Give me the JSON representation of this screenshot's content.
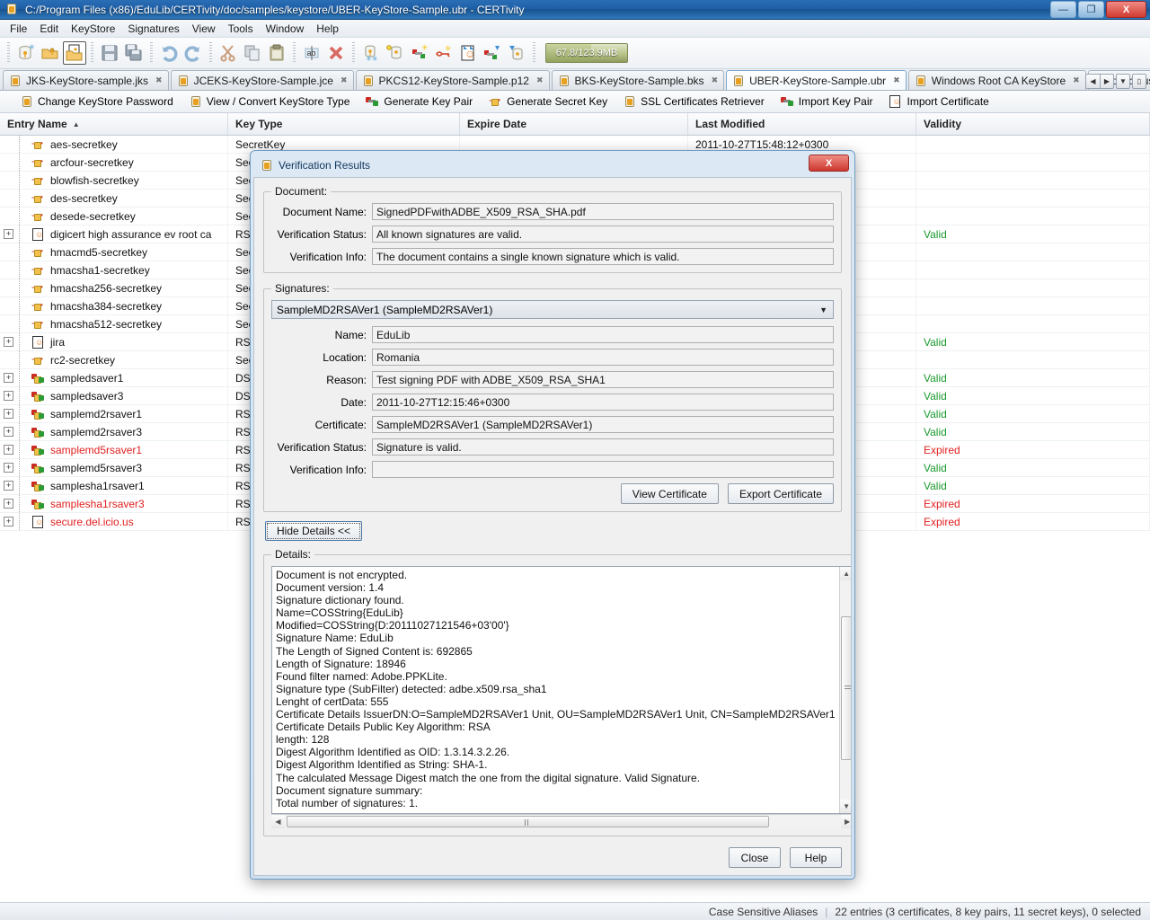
{
  "window": {
    "title": "C:/Program Files (x86)/EduLib/CERTivity/doc/samples/keystore/UBER-KeyStore-Sample.ubr - CERTivity",
    "minimize": "—",
    "maximize": "❐",
    "close": "X"
  },
  "menubar": {
    "items": [
      "File",
      "Edit",
      "KeyStore",
      "Signatures",
      "View",
      "Tools",
      "Window",
      "Help"
    ]
  },
  "toolbar": {
    "memory_label": "67.8/123.9MB",
    "icons": [
      "new-keystore-icon",
      "open-keystore-icon",
      "open-ca-keystore-icon",
      "save-icon",
      "save-all-icon",
      "undo-icon",
      "redo-icon",
      "cut-icon",
      "copy-icon",
      "paste-icon",
      "rename-icon",
      "delete-icon",
      "change-password-icon",
      "view-convert-keystore-icon",
      "generate-key-pair-icon",
      "generate-secret-key-icon",
      "ssl-certificates-retriever-icon",
      "import-key-pair-icon",
      "import-certificate-icon"
    ]
  },
  "tabs": [
    {
      "label": "JKS-KeyStore-sample.jks",
      "icon": "keystore-icon",
      "active": false
    },
    {
      "label": "JCEKS-KeyStore-Sample.jce",
      "icon": "keystore-icon",
      "active": false
    },
    {
      "label": "PKCS12-KeyStore-Sample.p12",
      "icon": "keystore-icon",
      "active": false
    },
    {
      "label": "BKS-KeyStore-Sample.bks",
      "icon": "keystore-icon",
      "active": false
    },
    {
      "label": "UBER-KeyStore-Sample.ubr",
      "icon": "keystore-icon",
      "active": true
    },
    {
      "label": "Windows Root CA KeyStore",
      "icon": "keystore-icon",
      "active": false
    },
    {
      "label": "delicious.cer",
      "icon": "certificate-icon",
      "active": false
    }
  ],
  "tab_close_glyph": "✖",
  "actionbar": {
    "items": [
      {
        "label": "Change KeyStore Password",
        "icon": "change-password-icon"
      },
      {
        "label": "View / Convert KeyStore Type",
        "icon": "view-convert-keystore-icon"
      },
      {
        "label": "Generate Key Pair",
        "icon": "generate-key-pair-icon"
      },
      {
        "label": "Generate Secret Key",
        "icon": "generate-secret-key-icon"
      },
      {
        "label": "SSL Certificates Retriever",
        "icon": "ssl-certificates-retriever-icon"
      },
      {
        "label": "Import Key Pair",
        "icon": "import-key-pair-icon"
      },
      {
        "label": "Import Certificate",
        "icon": "import-certificate-icon"
      }
    ]
  },
  "table": {
    "columns": [
      "Entry Name",
      "Key Type",
      "Expire Date",
      "Last Modified",
      "Validity"
    ],
    "sort_column": "Entry Name",
    "sort_arrow": "▲",
    "rows": [
      {
        "name": "aes-secretkey",
        "icon": "secret-key-icon",
        "expandable": false,
        "key_type": "SecretKey",
        "expire": "",
        "modified": "2011-10-27T15:48:12+0300",
        "validity": ""
      },
      {
        "name": "arcfour-secretkey",
        "icon": "secret-key-icon",
        "expandable": false,
        "key_type": "SecretKey",
        "expire": "",
        "modified": "",
        "validity": ""
      },
      {
        "name": "blowfish-secretkey",
        "icon": "secret-key-icon",
        "expandable": false,
        "key_type": "SecretKey",
        "expire": "",
        "modified": "",
        "validity": ""
      },
      {
        "name": "des-secretkey",
        "icon": "secret-key-icon",
        "expandable": false,
        "key_type": "SecretKey",
        "expire": "",
        "modified": "",
        "validity": ""
      },
      {
        "name": "desede-secretkey",
        "icon": "secret-key-icon",
        "expandable": false,
        "key_type": "SecretKey",
        "expire": "",
        "modified": "",
        "validity": ""
      },
      {
        "name": "digicert high assurance ev root ca",
        "icon": "certificate-icon",
        "expandable": true,
        "key_type": "RSA",
        "expire": "",
        "modified": "",
        "validity": "Valid"
      },
      {
        "name": "hmacmd5-secretkey",
        "icon": "secret-key-icon",
        "expandable": false,
        "key_type": "SecretKey",
        "expire": "",
        "modified": "",
        "validity": ""
      },
      {
        "name": "hmacsha1-secretkey",
        "icon": "secret-key-icon",
        "expandable": false,
        "key_type": "SecretKey",
        "expire": "",
        "modified": "",
        "validity": ""
      },
      {
        "name": "hmacsha256-secretkey",
        "icon": "secret-key-icon",
        "expandable": false,
        "key_type": "SecretKey",
        "expire": "",
        "modified": "",
        "validity": ""
      },
      {
        "name": "hmacsha384-secretkey",
        "icon": "secret-key-icon",
        "expandable": false,
        "key_type": "SecretKey",
        "expire": "",
        "modified": "",
        "validity": ""
      },
      {
        "name": "hmacsha512-secretkey",
        "icon": "secret-key-icon",
        "expandable": false,
        "key_type": "SecretKey",
        "expire": "",
        "modified": "",
        "validity": ""
      },
      {
        "name": "jira",
        "icon": "certificate-icon",
        "expandable": true,
        "key_type": "RSA",
        "expire": "",
        "modified": "",
        "validity": "Valid"
      },
      {
        "name": "rc2-secretkey",
        "icon": "secret-key-icon",
        "expandable": false,
        "key_type": "SecretKey",
        "expire": "",
        "modified": "",
        "validity": ""
      },
      {
        "name": "sampledsaver1",
        "icon": "key-pair-icon",
        "expandable": true,
        "key_type": "DSA",
        "expire": "",
        "modified": "",
        "validity": "Valid"
      },
      {
        "name": "sampledsaver3",
        "icon": "key-pair-icon",
        "expandable": true,
        "key_type": "DSA",
        "expire": "",
        "modified": "",
        "validity": "Valid"
      },
      {
        "name": "samplemd2rsaver1",
        "icon": "key-pair-icon",
        "expandable": true,
        "key_type": "RSA",
        "expire": "",
        "modified": "",
        "validity": "Valid"
      },
      {
        "name": "samplemd2rsaver3",
        "icon": "key-pair-icon",
        "expandable": true,
        "key_type": "RSA",
        "expire": "",
        "modified": "",
        "validity": "Valid"
      },
      {
        "name": "samplemd5rsaver1",
        "icon": "key-pair-icon",
        "expandable": true,
        "key_type": "RSA",
        "expire": "",
        "modified": "",
        "validity": "Expired",
        "expired_name": true
      },
      {
        "name": "samplemd5rsaver3",
        "icon": "key-pair-icon",
        "expandable": true,
        "key_type": "RSA",
        "expire": "",
        "modified": "",
        "validity": "Valid"
      },
      {
        "name": "samplesha1rsaver1",
        "icon": "key-pair-icon",
        "expandable": true,
        "key_type": "RSA",
        "expire": "",
        "modified": "",
        "validity": "Valid"
      },
      {
        "name": "samplesha1rsaver3",
        "icon": "key-pair-icon",
        "expandable": true,
        "key_type": "RSA",
        "expire": "",
        "modified": "",
        "validity": "Expired",
        "expired_name": true
      },
      {
        "name": "secure.del.icio.us",
        "icon": "certificate-icon",
        "expandable": true,
        "key_type": "RSA",
        "expire": "",
        "modified": "",
        "validity": "Expired",
        "expired_name": true
      }
    ]
  },
  "statusbar": {
    "case_sensitive": "Case Sensitive Aliases",
    "separator": "|",
    "entries": "22 entries (3 certificates, 8 key pairs, 11 secret keys), 0 selected"
  },
  "dialog": {
    "title": "Verification Results",
    "close_label": "X",
    "document_group": {
      "legend": "Document:",
      "fields": [
        {
          "label": "Document Name:",
          "value": "SignedPDFwithADBE_X509_RSA_SHA.pdf"
        },
        {
          "label": "Verification Status:",
          "value": "All known signatures are valid."
        },
        {
          "label": "Verification Info:",
          "value": "The document contains a single known signature which is valid."
        }
      ]
    },
    "signatures_group": {
      "legend": "Signatures:",
      "selected_signature": "SampleMD2RSAVer1 (SampleMD2RSAVer1)",
      "dropdown_arrow": "▼",
      "fields": [
        {
          "label": "Name:",
          "value": "EduLib"
        },
        {
          "label": "Location:",
          "value": "Romania"
        },
        {
          "label": "Reason:",
          "value": "Test signing PDF with ADBE_X509_RSA_SHA1"
        },
        {
          "label": "Date:",
          "value": "2011-10-27T12:15:46+0300"
        },
        {
          "label": "Certificate:",
          "value": "SampleMD2RSAVer1 (SampleMD2RSAVer1)"
        },
        {
          "label": "Verification Status:",
          "value": "Signature is valid."
        },
        {
          "label": "Verification Info:",
          "value": ""
        }
      ],
      "view_certificate": "View Certificate",
      "export_certificate": "Export Certificate"
    },
    "hide_details_label": "Hide Details <<",
    "details_group": {
      "legend": "Details:",
      "lines": [
        "Document is not encrypted.",
        "Document version: 1.4",
        "Signature dictionary found.",
        "Name=COSString{EduLib}",
        "Modified=COSString{D:20111027121546+03'00'}",
        "Signature Name: EduLib",
        "The Length of Signed Content is: 692865",
        "Length of Signature: 18946",
        "Found filter named: Adobe.PPKLite.",
        "Signature type (SubFilter) detected: adbe.x509.rsa_sha1",
        "Lenght of certData: 555",
        "Certificate Details IssuerDN:O=SampleMD2RSAVer1 Unit, OU=SampleMD2RSAVer1 Unit, CN=SampleMD2RSAVer1",
        "Certificate Details Public Key Algorithm: RSA",
        "length: 128",
        "Digest Algorithm Identified as OID: 1.3.14.3.2.26.",
        "Digest Algorithm Identified as String: SHA-1.",
        "The calculated Message Digest match the one from the digital signature. Valid Signature.",
        "Document signature summary:",
        "Total number of signatures: 1."
      ]
    },
    "footer": {
      "close": "Close",
      "help": "Help"
    }
  }
}
